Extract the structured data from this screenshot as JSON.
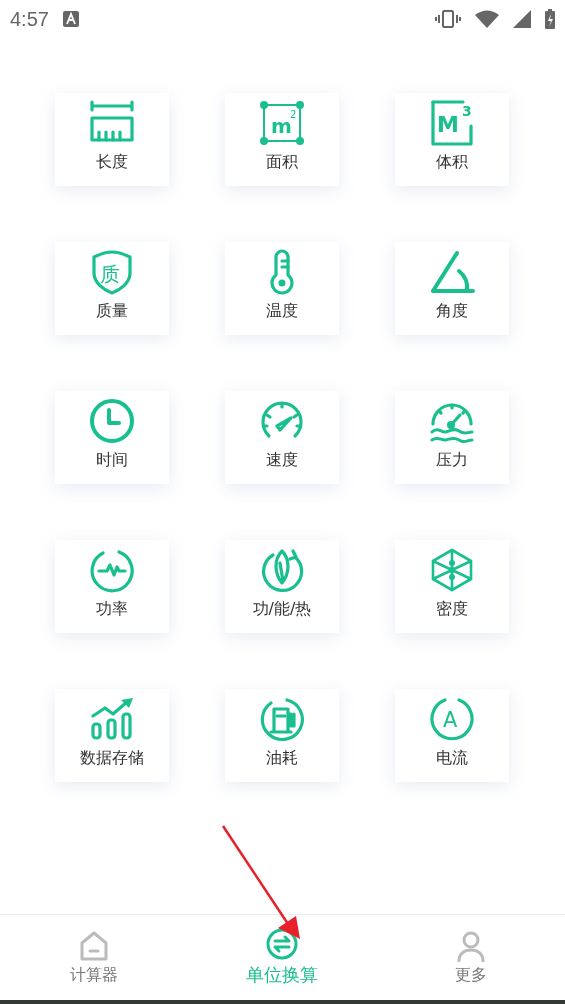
{
  "status_bar": {
    "time": "4:57"
  },
  "units": [
    {
      "label": "长度"
    },
    {
      "label": "面积",
      "superscript": "m",
      "exponent": "2"
    },
    {
      "label": "体积",
      "superscript": "M",
      "exponent": "3"
    },
    {
      "label": "质量",
      "badge": "质"
    },
    {
      "label": "温度"
    },
    {
      "label": "角度"
    },
    {
      "label": "时间"
    },
    {
      "label": "速度"
    },
    {
      "label": "压力"
    },
    {
      "label": "功率"
    },
    {
      "label": "功/能/热"
    },
    {
      "label": "密度"
    },
    {
      "label": "数据存储"
    },
    {
      "label": "油耗"
    },
    {
      "label": "电流",
      "badge": "A"
    }
  ],
  "bottom_nav": [
    {
      "label": "计算器",
      "selected": false
    },
    {
      "label": "单位换算",
      "selected": true
    },
    {
      "label": "更多",
      "selected": false
    }
  ]
}
